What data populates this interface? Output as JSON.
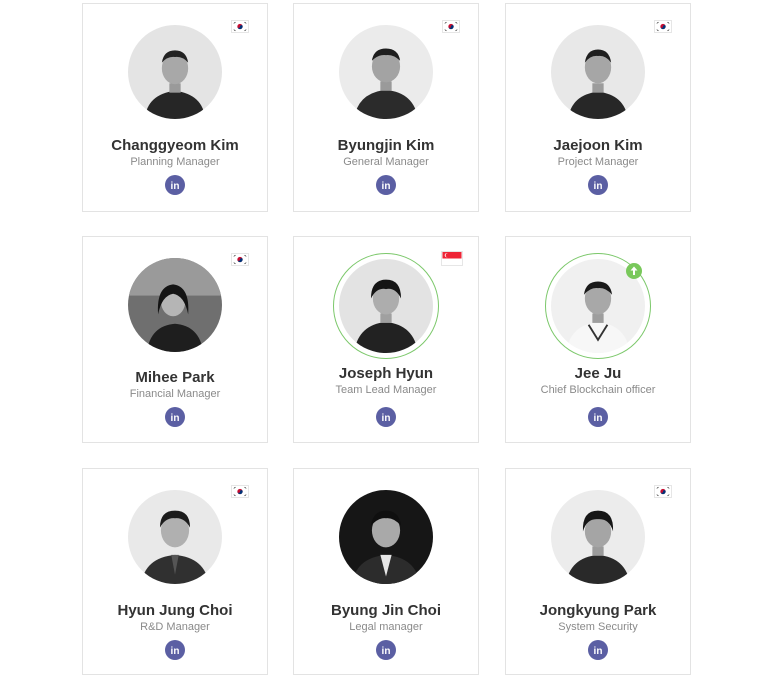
{
  "colors": {
    "card_border": "#e3e3e3",
    "name_text": "#333333",
    "role_text": "#8a8a8a",
    "linkedin_button": "#5b5fa3",
    "highlight_ring": "#7cc86b",
    "badge": "#79c85b"
  },
  "icons": {
    "linkedin": "linkedin-icon",
    "korea_flag": "south-korea-flag-icon",
    "singapore_flag": "singapore-flag-icon",
    "up_badge": "arrow-up-icon"
  },
  "team": [
    {
      "name": "Changgyeom Kim",
      "role": "Planning Manager",
      "flag": "KR",
      "highlighted": false
    },
    {
      "name": "Byungjin Kim",
      "role": "General Manager",
      "flag": "KR",
      "highlighted": false
    },
    {
      "name": "Jaejoon Kim",
      "role": "Project Manager",
      "flag": "KR",
      "highlighted": false
    },
    {
      "name": "Mihee Park",
      "role": "Financial Manager",
      "flag": "KR",
      "highlighted": false
    },
    {
      "name": "Joseph Hyun",
      "role": "Team Lead Manager",
      "flag": "SG",
      "highlighted": true
    },
    {
      "name": "Jee Ju",
      "role": "Chief Blockchain officer",
      "flag": "UP",
      "highlighted": true
    },
    {
      "name": "Hyun Jung Choi",
      "role": "R&D Manager",
      "flag": "KR",
      "highlighted": false
    },
    {
      "name": "Byung Jin Choi",
      "role": "Legal manager",
      "flag": "",
      "highlighted": false
    },
    {
      "name": "Jongkyung Park",
      "role": "System Security",
      "flag": "KR",
      "highlighted": false
    }
  ]
}
